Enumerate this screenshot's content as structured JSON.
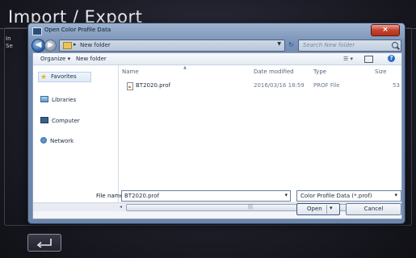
{
  "app": {
    "title": "Import / Export",
    "left_stub": [
      "In",
      "Se"
    ]
  },
  "dialog": {
    "title": "Open Color Profile Data",
    "close_label": "×",
    "address": {
      "path": "New folder"
    },
    "search": {
      "placeholder": "Search New folder"
    },
    "toolbar": {
      "organize_label": "Organize ▾",
      "new_folder_label": "New folder"
    },
    "nav_pane": {
      "items": [
        {
          "label": "Favorites",
          "icon": "star-icon"
        },
        {
          "label": "Libraries",
          "icon": "library-icon"
        },
        {
          "label": "Computer",
          "icon": "computer-icon"
        },
        {
          "label": "Network",
          "icon": "network-icon"
        }
      ]
    },
    "columns": {
      "name": "Name",
      "date": "Date modified",
      "type": "Type",
      "size": "Size"
    },
    "files": [
      {
        "name": "BT2020.prof",
        "date": "2016/03/16 18:59",
        "type": "PROF File",
        "size": "53"
      }
    ],
    "file_name": {
      "label": "File name:",
      "value": "BT2020.prof"
    },
    "filter": {
      "value": "Color Profile Data (*.prof)"
    },
    "buttons": {
      "open": "Open",
      "cancel": "Cancel"
    }
  },
  "colors": {
    "background": "#1c1c26",
    "dialog_frame": "#7d95b8",
    "close_button": "#c4432e"
  }
}
